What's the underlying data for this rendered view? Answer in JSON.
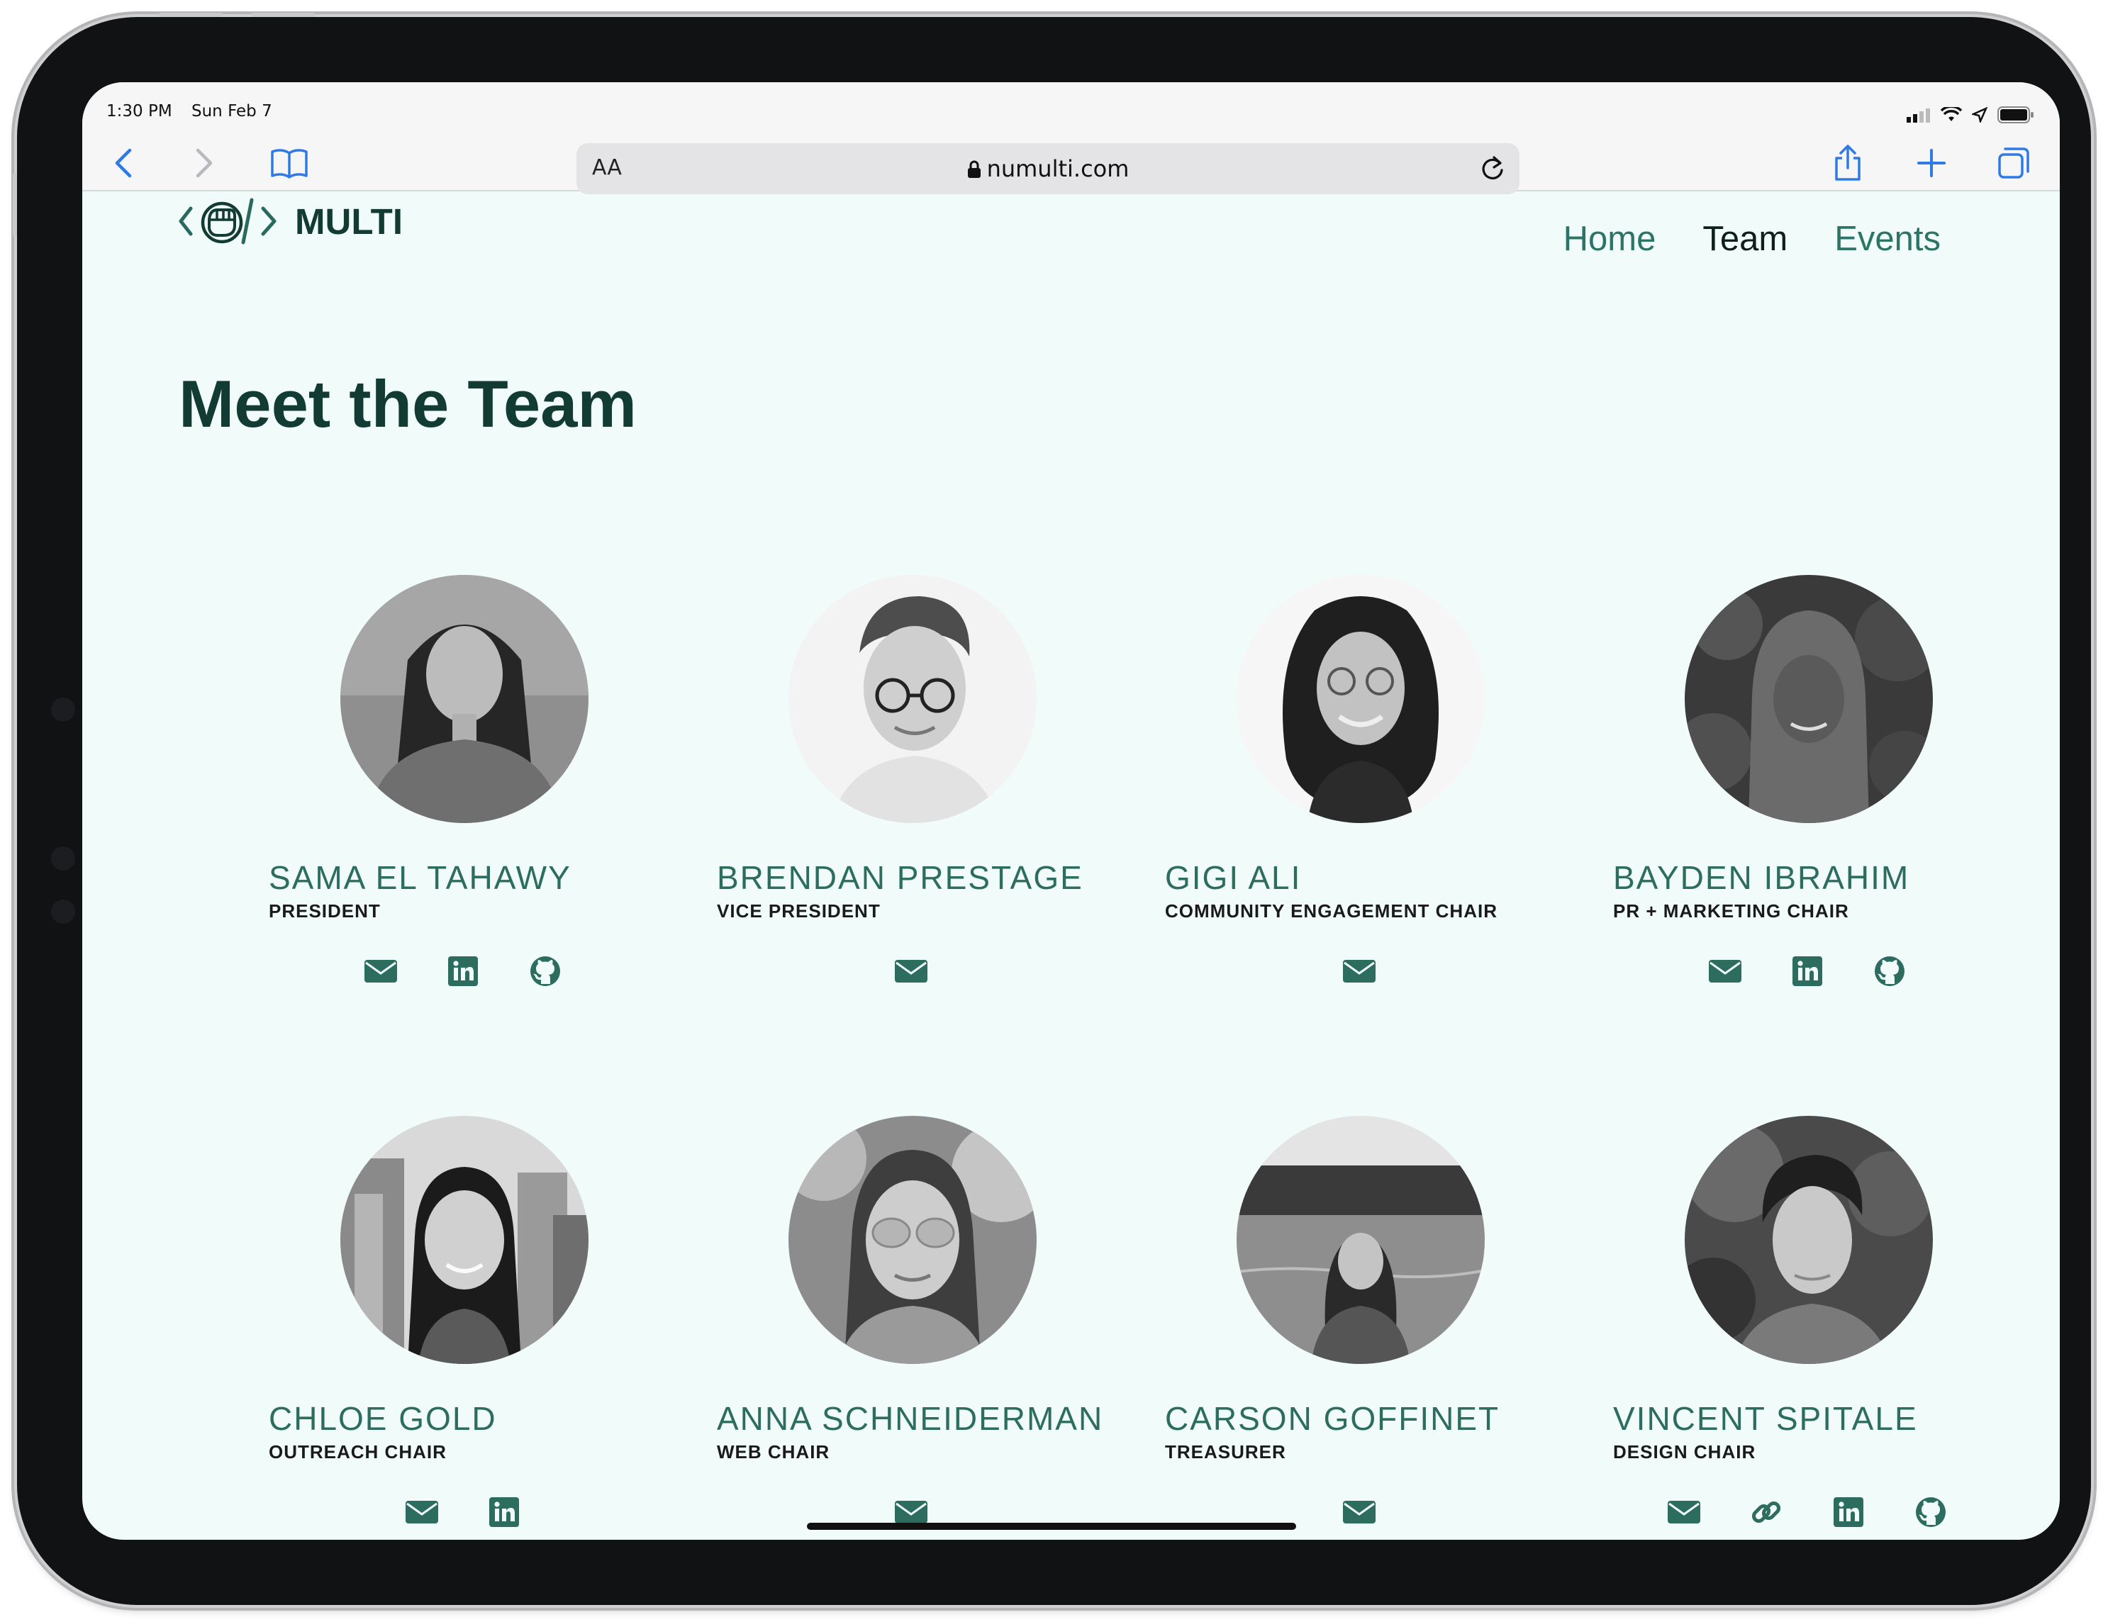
{
  "status_bar": {
    "time": "1:30 PM",
    "date": "Sun Feb 7"
  },
  "browser": {
    "text_size_label": "AA",
    "url": "numulti.com"
  },
  "site": {
    "logo_text": "MULTI",
    "nav": [
      {
        "label": "Home",
        "active": false
      },
      {
        "label": "Team",
        "active": true
      },
      {
        "label": "Events",
        "active": false
      }
    ],
    "page_title": "Meet the Team"
  },
  "accent_color": "#2c6d60",
  "page_background": "#f1fbfa",
  "team": [
    {
      "name": "SAMA EL TAHAWY",
      "role": "PRESIDENT",
      "links": [
        "email-icon",
        "linkedin-icon",
        "github-icon"
      ]
    },
    {
      "name": "BRENDAN PRESTAGE",
      "role": "VICE PRESIDENT",
      "links": [
        "email-icon"
      ]
    },
    {
      "name": "GIGI ALI",
      "role": "COMMUNITY ENGAGEMENT CHAIR",
      "links": [
        "email-icon"
      ]
    },
    {
      "name": "BAYDEN IBRAHIM",
      "role": "PR + MARKETING CHAIR",
      "links": [
        "email-icon",
        "linkedin-icon",
        "github-icon"
      ]
    },
    {
      "name": "CHLOE GOLD",
      "role": "OUTREACH CHAIR",
      "links": [
        "email-icon",
        "linkedin-icon"
      ]
    },
    {
      "name": "ANNA SCHNEIDERMAN",
      "role": "WEB CHAIR",
      "links": [
        "email-icon"
      ]
    },
    {
      "name": "CARSON GOFFINET",
      "role": "TREASURER",
      "links": [
        "email-icon"
      ]
    },
    {
      "name": "VINCENT SPITALE",
      "role": "DESIGN CHAIR",
      "links": [
        "email-icon",
        "link-icon",
        "linkedin-icon",
        "github-icon"
      ]
    }
  ]
}
